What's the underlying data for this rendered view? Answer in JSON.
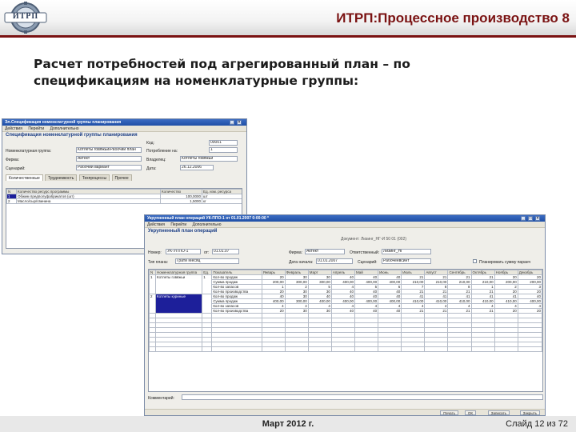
{
  "slide": {
    "logo_text": "ИТРП",
    "title": "ИТРП:Процессное производство 8",
    "heading_line1": "Расчет потребностей под агрегированный план – по",
    "heading_line2": "спецификациям на номенклатурные группы:",
    "footer_date": "Март 2012 г.",
    "footer_slide": "Слайд 12 из 72"
  },
  "colors": {
    "brand": "#7a1212",
    "window_title": "#1f4ea6",
    "selection": "#1d1f9a"
  },
  "spec_window": {
    "title": "Эл.Спецификация номенклатурной группы планирования",
    "toolbar": [
      "Действия",
      "Перейти",
      "Дополнительно"
    ],
    "section": "Спецификация номенклатурной группы планирования",
    "fields": {
      "kod_label": "Код:",
      "kod_value": "00001",
      "group_label": "Номенклатурная группа:",
      "group_value": "Котлеты говяжьи/Рабочий план",
      "period_label": "Потребление на:",
      "period_value": "1",
      "firm_label": "Фирма:",
      "firm_value": "Актект",
      "vladelec_label": "Владелец:",
      "vladelec_value": "Котлеты говяжьи",
      "scenario_label": "Сценарий:",
      "scenario_value": "Рабочий вариант",
      "date_label": "Дата:",
      "date_value": "26.12.2006"
    },
    "tabs": [
      "Количественные",
      "Трудоемкость",
      "Техпроцессы",
      "Прочее"
    ],
    "table": {
      "headers": [
        "N",
        "Количество ресурс программы",
        "Количество",
        "Ед. изм. ресурса"
      ],
      "rows": [
        [
          "1",
          "Обжим предполуфабрикатов (шт)",
          "100,0000",
          "шт"
        ],
        [
          "2",
          "Масло/сыр/свинина",
          "1,5000",
          "кг"
        ]
      ]
    }
  },
  "plan_window": {
    "title": "Укрупненный план операций УК-ППО-1 от 01.01.2007 0:00:00 *",
    "toolbar": [
      "Действия",
      "Перейти",
      "Дополнительно"
    ],
    "section": "Укрупненный план операций",
    "info": "Документ: Лизинг_НГ-И 50 01 (002)",
    "fields": {
      "number_label": "Номер:",
      "number_value": "УК-УППО-1",
      "from_label": "от:",
      "from_value": "01.01.07",
      "firm_label": "Фирма:",
      "firm_value": "Актект",
      "resp_label": "Ответственный:",
      "resp_value": "Лизинг_НГ",
      "plan_type_label": "Тип плана:",
      "plan_type_value": "Грати Месяц",
      "date_label": "Дата начала:",
      "date_value": "01.01.2007",
      "scenario_label": "Сценарий:",
      "scenario_value": "Рабочеевсинт",
      "option_label": "Планировать сумму паранч"
    },
    "table": {
      "headers": [
        "N",
        "Номенклатурная группа",
        "Ед.",
        "Показатель",
        "Январь",
        "Февраль",
        "Март",
        "Апрель",
        "Май",
        "Июнь",
        "Июль",
        "Август",
        "Сентябрь",
        "Октябрь",
        "Ноябрь",
        "Декабрь"
      ],
      "groups": [
        {
          "n": "1",
          "name": "Котлеты говяжьи",
          "unit": "1",
          "rows": [
            [
              "Кол-во продаж",
              "20",
              "30",
              "30",
              "40",
              "40",
              "40",
              "21",
              "21",
              "21",
              "21",
              "20",
              "20"
            ],
            [
              "Сумма продаж",
              "200,00",
              "300,00",
              "300,00",
              "400,00",
              "400,00",
              "400,00",
              "210,00",
              "210,00",
              "210,00",
              "210,00",
              "200,00",
              "200,00"
            ],
            [
              "Кол-во запасов",
              "1",
              "2",
              "5",
              "4",
              "5",
              "6",
              "7",
              "8",
              "8",
              "1",
              "2",
              "3"
            ],
            [
              "Кол-во производства",
              "20",
              "30",
              "30",
              "40",
              "40",
              "40",
              "21",
              "21",
              "21",
              "21",
              "20",
              "20"
            ]
          ]
        },
        {
          "n": "2",
          "name": "Котлеты куриные",
          "unit": "",
          "rows": [
            [
              "Кол-во продаж",
              "40",
              "30",
              "40",
              "40",
              "40",
              "40",
              "41",
              "41",
              "41",
              "41",
              "41",
              "40"
            ],
            [
              "Сумма продаж",
              "400,00",
              "300,00",
              "400,00",
              "400,00",
              "400,00",
              "400,00",
              "410,00",
              "410,00",
              "410,00",
              "410,00",
              "410,00",
              "400,00"
            ],
            [
              "Кол-во запасов",
              "4",
              "4",
              "4",
              "4",
              "4",
              "4",
              "4",
              "4",
              "4",
              "4",
              "4",
              "4"
            ],
            [
              "Кол-во производства",
              "20",
              "30",
              "30",
              "40",
              "40",
              "40",
              "21",
              "21",
              "21",
              "21",
              "20",
              "20"
            ]
          ]
        }
      ]
    },
    "comment_label": "Комментарий:",
    "status_buttons": [
      "Печать",
      "ОК",
      "Записать",
      "Закрыть"
    ]
  }
}
